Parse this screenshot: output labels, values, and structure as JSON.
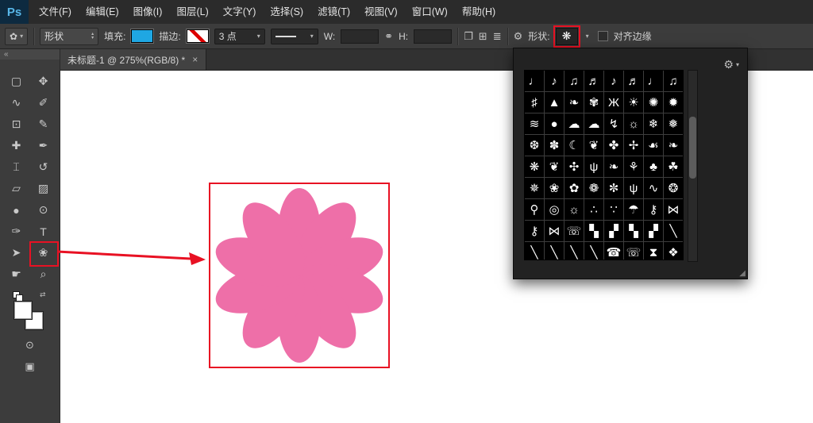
{
  "menu_bar": {
    "logo": "Ps",
    "items": [
      {
        "label": "文件(F)"
      },
      {
        "label": "编辑(E)"
      },
      {
        "label": "图像(I)"
      },
      {
        "label": "图层(L)"
      },
      {
        "label": "文字(Y)"
      },
      {
        "label": "选择(S)"
      },
      {
        "label": "滤镜(T)"
      },
      {
        "label": "视图(V)"
      },
      {
        "label": "窗口(W)"
      },
      {
        "label": "帮助(H)"
      }
    ]
  },
  "options_bar": {
    "preset": {
      "glyph": "✿"
    },
    "mode": {
      "value": "形状"
    },
    "fill": {
      "label": "填充:",
      "color": "#1FA7E3"
    },
    "stroke": {
      "label": "描边:"
    },
    "stroke_width": {
      "value": "3 点"
    },
    "w_field": {
      "label": "W:",
      "value": ""
    },
    "h_field": {
      "label": "H:",
      "value": ""
    },
    "shape": {
      "label": "形状:",
      "thumb_glyph": "❋"
    },
    "align_edges": {
      "label": "对齐边缘",
      "checked": false
    }
  },
  "icons": {
    "caret_down": "▾",
    "caret_up": "▴",
    "link": "⚭",
    "gear": "⚙",
    "path_ops": "❐",
    "path_align": "⊞",
    "path_arrange": "≣",
    "collapse": "«",
    "close": "×",
    "swap": "⇄",
    "grip": "◢"
  },
  "document_tab": {
    "title": "未标题-1 @ 275%(RGB/8) *"
  },
  "toolbar": {
    "tools": [
      {
        "name": "rectangular-marquee-tool",
        "glyph": "▢"
      },
      {
        "name": "move-tool",
        "glyph": "✥"
      },
      {
        "name": "lasso-tool",
        "glyph": "∿"
      },
      {
        "name": "quick-selection-tool",
        "glyph": "✐"
      },
      {
        "name": "crop-tool",
        "glyph": "⊡"
      },
      {
        "name": "eyedropper-tool",
        "glyph": "✎"
      },
      {
        "name": "spot-healing-brush-tool",
        "glyph": "✚"
      },
      {
        "name": "brush-tool",
        "glyph": "✒"
      },
      {
        "name": "clone-stamp-tool",
        "glyph": "⌶"
      },
      {
        "name": "history-brush-tool",
        "glyph": "↺"
      },
      {
        "name": "eraser-tool",
        "glyph": "▱"
      },
      {
        "name": "gradient-tool",
        "glyph": "▨"
      },
      {
        "name": "blur-tool",
        "glyph": "●"
      },
      {
        "name": "dodge-tool",
        "glyph": "⊙"
      },
      {
        "name": "pen-tool",
        "glyph": "✑"
      },
      {
        "name": "horizontal-type-tool",
        "glyph": "T"
      },
      {
        "name": "path-selection-tool",
        "glyph": "➤"
      },
      {
        "name": "custom-shape-tool",
        "glyph": "❀"
      },
      {
        "name": "hand-tool",
        "glyph": "☛"
      },
      {
        "name": "zoom-tool",
        "glyph": "⌕"
      }
    ],
    "bottom": [
      {
        "name": "edit-in-quick-mask-button",
        "glyph": "⊙"
      },
      {
        "name": "screen-mode-button",
        "glyph": "▣"
      }
    ]
  },
  "shape_picker": {
    "shapes": [
      {
        "name": "shape-quarter-note",
        "glyph": "♩"
      },
      {
        "name": "shape-eighth-note",
        "glyph": "♪"
      },
      {
        "name": "shape-beamed-eighth-notes",
        "glyph": "♫"
      },
      {
        "name": "shape-beamed-sixteenth-notes",
        "glyph": "♬"
      },
      {
        "name": "shape-eighth-note-2",
        "glyph": "♪"
      },
      {
        "name": "shape-beamed-notes",
        "glyph": "♬"
      },
      {
        "name": "shape-quarter-note-2",
        "glyph": "♩"
      },
      {
        "name": "shape-music-note",
        "glyph": "♫"
      },
      {
        "name": "shape-sharp-sign",
        "glyph": "♯"
      },
      {
        "name": "shape-fir-tree",
        "glyph": "▲"
      },
      {
        "name": "shape-fern",
        "glyph": "❧"
      },
      {
        "name": "shape-flower",
        "glyph": "✾"
      },
      {
        "name": "shape-butterfly",
        "glyph": "Ж"
      },
      {
        "name": "shape-sun-swirl",
        "glyph": "☀"
      },
      {
        "name": "shape-starburst",
        "glyph": "✺"
      },
      {
        "name": "shape-spiky-burst",
        "glyph": "✹"
      },
      {
        "name": "shape-waves",
        "glyph": "≋"
      },
      {
        "name": "shape-raindrop",
        "glyph": "●"
      },
      {
        "name": "shape-cloud",
        "glyph": "☁"
      },
      {
        "name": "shape-cloud-outline",
        "glyph": "☁"
      },
      {
        "name": "shape-lightning",
        "glyph": "↯"
      },
      {
        "name": "shape-sun",
        "glyph": "☼"
      },
      {
        "name": "shape-snowflake-1",
        "glyph": "❄"
      },
      {
        "name": "shape-snowflake-2",
        "glyph": "❅"
      },
      {
        "name": "shape-snowflake-3",
        "glyph": "❆"
      },
      {
        "name": "shape-ornament-flower",
        "glyph": "✽"
      },
      {
        "name": "shape-crescent-moon",
        "glyph": "☾"
      },
      {
        "name": "shape-leaf-1",
        "glyph": "❦"
      },
      {
        "name": "shape-hemp-leaf",
        "glyph": "✤"
      },
      {
        "name": "shape-leaf-2",
        "glyph": "✢"
      },
      {
        "name": "shape-chestnut-leaf",
        "glyph": "☙"
      },
      {
        "name": "shape-leaf-3",
        "glyph": "❧"
      },
      {
        "name": "shape-maple-leaf",
        "glyph": "❋"
      },
      {
        "name": "shape-oak-leaf",
        "glyph": "❦"
      },
      {
        "name": "shape-maple-leaf-2",
        "glyph": "✣"
      },
      {
        "name": "shape-grass",
        "glyph": "ψ"
      },
      {
        "name": "shape-vine",
        "glyph": "❧"
      },
      {
        "name": "shape-herb",
        "glyph": "⚘"
      },
      {
        "name": "shape-clover",
        "glyph": "♣"
      },
      {
        "name": "shape-shamrock",
        "glyph": "☘"
      },
      {
        "name": "shape-sunflower",
        "glyph": "✵"
      },
      {
        "name": "shape-flower-2",
        "glyph": "❀"
      },
      {
        "name": "shape-flower-3",
        "glyph": "✿"
      },
      {
        "name": "shape-daisy",
        "glyph": "❁"
      },
      {
        "name": "shape-flower-4",
        "glyph": "✼"
      },
      {
        "name": "shape-grass-2",
        "glyph": "ψ"
      },
      {
        "name": "shape-seaweed",
        "glyph": "∿"
      },
      {
        "name": "shape-light-bulb",
        "glyph": "❂"
      },
      {
        "name": "shape-light-bulb-2",
        "glyph": "⚲"
      },
      {
        "name": "shape-light-bulb-outline",
        "glyph": "◎"
      },
      {
        "name": "shape-sun-2",
        "glyph": "☼"
      },
      {
        "name": "shape-footprints-1",
        "glyph": "∴"
      },
      {
        "name": "shape-footprints-2",
        "glyph": "∵"
      },
      {
        "name": "shape-umbrella",
        "glyph": "☂"
      },
      {
        "name": "shape-key",
        "glyph": "⚷"
      },
      {
        "name": "shape-bow",
        "glyph": "⋈"
      },
      {
        "name": "shape-key-2",
        "glyph": "⚷"
      },
      {
        "name": "shape-ribbon",
        "glyph": "⋈"
      },
      {
        "name": "shape-telephone",
        "glyph": "☏"
      },
      {
        "name": "shape-puzzle-1",
        "glyph": "▚"
      },
      {
        "name": "shape-puzzle-2",
        "glyph": "▞"
      },
      {
        "name": "shape-puzzle-3",
        "glyph": "▚"
      },
      {
        "name": "shape-puzzle-4",
        "glyph": "▞"
      },
      {
        "name": "shape-diagonal-line",
        "glyph": "╲"
      },
      {
        "name": "shape-diagonal-line-2",
        "glyph": "╲"
      },
      {
        "name": "shape-diagonal-line-3",
        "glyph": "╲"
      },
      {
        "name": "shape-diagonal-line-4",
        "glyph": "╲"
      },
      {
        "name": "shape-diagonal-line-5",
        "glyph": "╲"
      },
      {
        "name": "shape-telephone-2",
        "glyph": "☎"
      },
      {
        "name": "shape-telephone-3",
        "glyph": "☏"
      },
      {
        "name": "shape-hourglass",
        "glyph": "⧗"
      },
      {
        "name": "shape-ornament",
        "glyph": "❖"
      }
    ]
  },
  "canvas": {
    "flower_color": "#EE6FA8",
    "petal_count": 10
  },
  "annotations": {
    "color": "#E81123"
  }
}
